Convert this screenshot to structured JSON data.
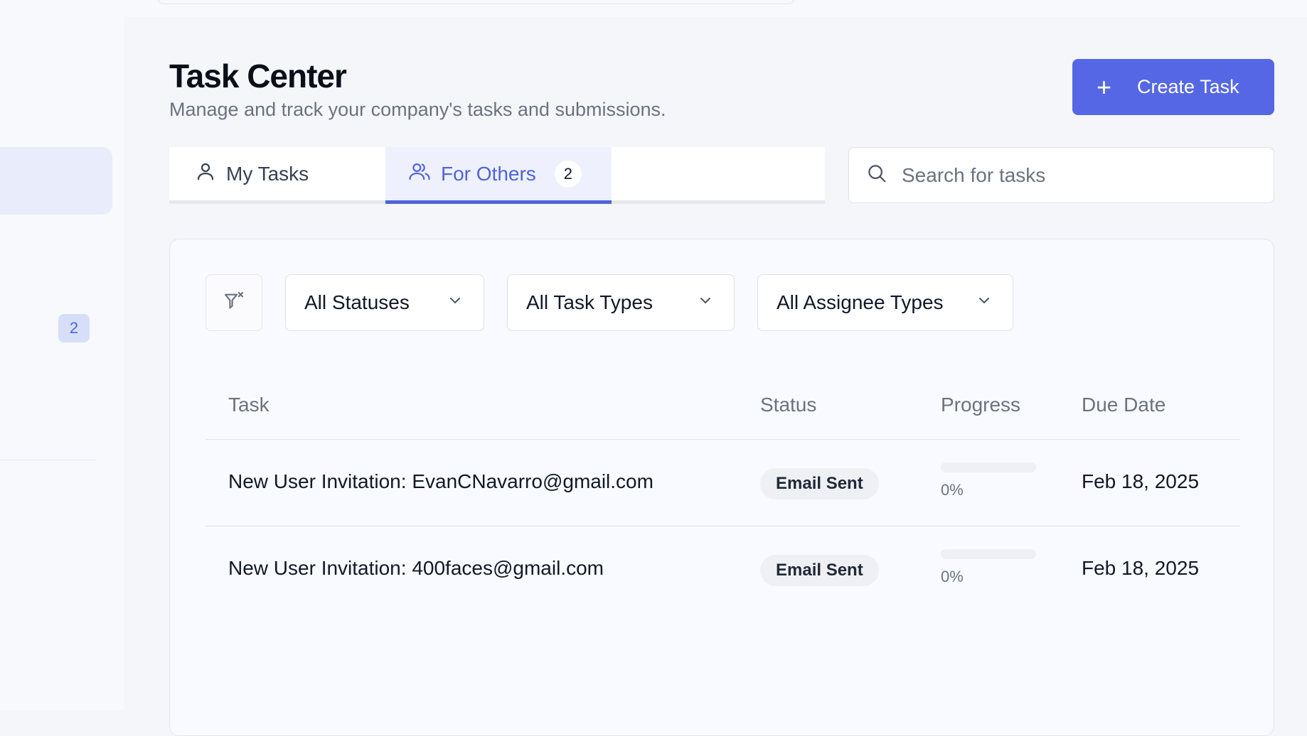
{
  "sidebar": {
    "active_badge": "2"
  },
  "header": {
    "title": "Task Center",
    "subtitle": "Manage and track your company's tasks and submissions.",
    "create_label": "Create Task"
  },
  "tabs": [
    {
      "label": "My Tasks",
      "icon": "user-icon",
      "active": false
    },
    {
      "label": "For Others",
      "icon": "users-icon",
      "active": true,
      "count": "2"
    }
  ],
  "search": {
    "placeholder": "Search for tasks",
    "value": ""
  },
  "filters": {
    "clear_icon": "filter-clear-icon",
    "status": "All Statuses",
    "task_type": "All Task Types",
    "assignee_type": "All Assignee Types"
  },
  "table": {
    "columns": [
      "Task",
      "Status",
      "Progress",
      "Due Date"
    ],
    "rows": [
      {
        "task": "New User Invitation: EvanCNavarro@gmail.com",
        "status": "Email Sent",
        "progress_label": "0%",
        "progress": 0,
        "due": "Feb 18, 2025"
      },
      {
        "task": "New User Invitation: 400faces@gmail.com",
        "status": "Email Sent",
        "progress_label": "0%",
        "progress": 0,
        "due": "Feb 18, 2025"
      }
    ]
  },
  "colors": {
    "accent": "#5567e4",
    "accent_text": "#4f63db",
    "muted_text": "#6b7280"
  }
}
